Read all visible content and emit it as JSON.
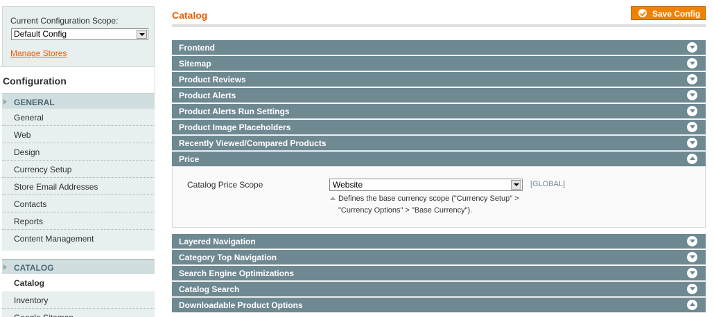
{
  "sidebar": {
    "scope_label": "Current Configuration Scope:",
    "scope_value": "Default Config",
    "manage_stores": "Manage Stores",
    "title": "Configuration",
    "groups": [
      {
        "label": "GENERAL",
        "items": [
          {
            "label": "General"
          },
          {
            "label": "Web"
          },
          {
            "label": "Design"
          },
          {
            "label": "Currency Setup"
          },
          {
            "label": "Store Email Addresses"
          },
          {
            "label": "Contacts"
          },
          {
            "label": "Reports"
          },
          {
            "label": "Content Management"
          }
        ]
      },
      {
        "label": "CATALOG",
        "items": [
          {
            "label": "Catalog",
            "active": true
          },
          {
            "label": "Inventory"
          },
          {
            "label": "Google Sitemap"
          }
        ]
      }
    ]
  },
  "header": {
    "title": "Catalog",
    "save_label": "Save Config"
  },
  "sections": [
    {
      "label": "Frontend",
      "expanded": false
    },
    {
      "label": "Sitemap",
      "expanded": false
    },
    {
      "label": "Product Reviews",
      "expanded": false
    },
    {
      "label": "Product Alerts",
      "expanded": false
    },
    {
      "label": "Product Alerts Run Settings",
      "expanded": false
    },
    {
      "label": "Product Image Placeholders",
      "expanded": false
    },
    {
      "label": "Recently Viewed/Compared Products",
      "expanded": false
    },
    {
      "label": "Price",
      "expanded": true
    },
    {
      "label": "Layered Navigation",
      "expanded": false
    },
    {
      "label": "Category Top Navigation",
      "expanded": false
    },
    {
      "label": "Search Engine Optimizations",
      "expanded": false
    },
    {
      "label": "Catalog Search",
      "expanded": false
    },
    {
      "label": "Downloadable Product Options",
      "expanded": true
    }
  ],
  "price": {
    "field_label": "Catalog Price Scope",
    "value": "Website",
    "scope": "[GLOBAL]",
    "note_line1": "Defines the base currency scope (\"Currency Setup\" >",
    "note_line2": "\"Currency Options\" > \"Base Currency\")."
  },
  "colors": {
    "accent": "#eb5e00",
    "button": "#f18200",
    "section_header": "#6f8992",
    "sidebar_bg": "#e7efef",
    "group_header": "#d1dedf"
  },
  "icons": {
    "save": "check-circle-icon",
    "collapsed": "chevron-down-icon",
    "expanded": "chevron-up-icon"
  }
}
